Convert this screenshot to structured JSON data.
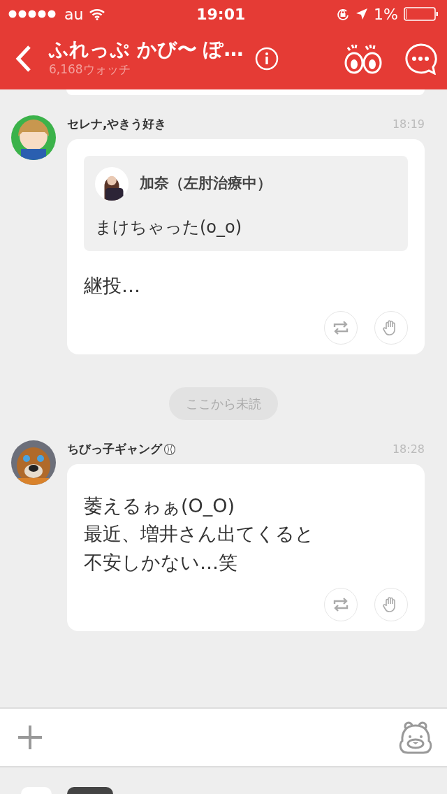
{
  "status_bar": {
    "carrier": "au",
    "time": "19:01",
    "battery": "1%"
  },
  "header": {
    "title": "ふれっぷ かび〜 ぽ…",
    "subtitle": "6,168ウォッチ"
  },
  "timeline": [
    {
      "kind": "message",
      "author": "セレナ,やきう好き",
      "time": "18:19",
      "baseball_badge": false,
      "quote": {
        "author": "加奈（左肘治療中）",
        "text": "まけちゃった(o_o)"
      },
      "lines": [
        "継投…"
      ]
    },
    {
      "kind": "unread_divider",
      "label": "ここから未読"
    },
    {
      "kind": "message",
      "author": "ちびっ子ギャング",
      "time": "18:28",
      "baseball_badge": true,
      "lines": [
        "萎えるゎぁ(O_O)",
        "最近、増井さん出てくると",
        "不安しかない…笑"
      ]
    }
  ]
}
